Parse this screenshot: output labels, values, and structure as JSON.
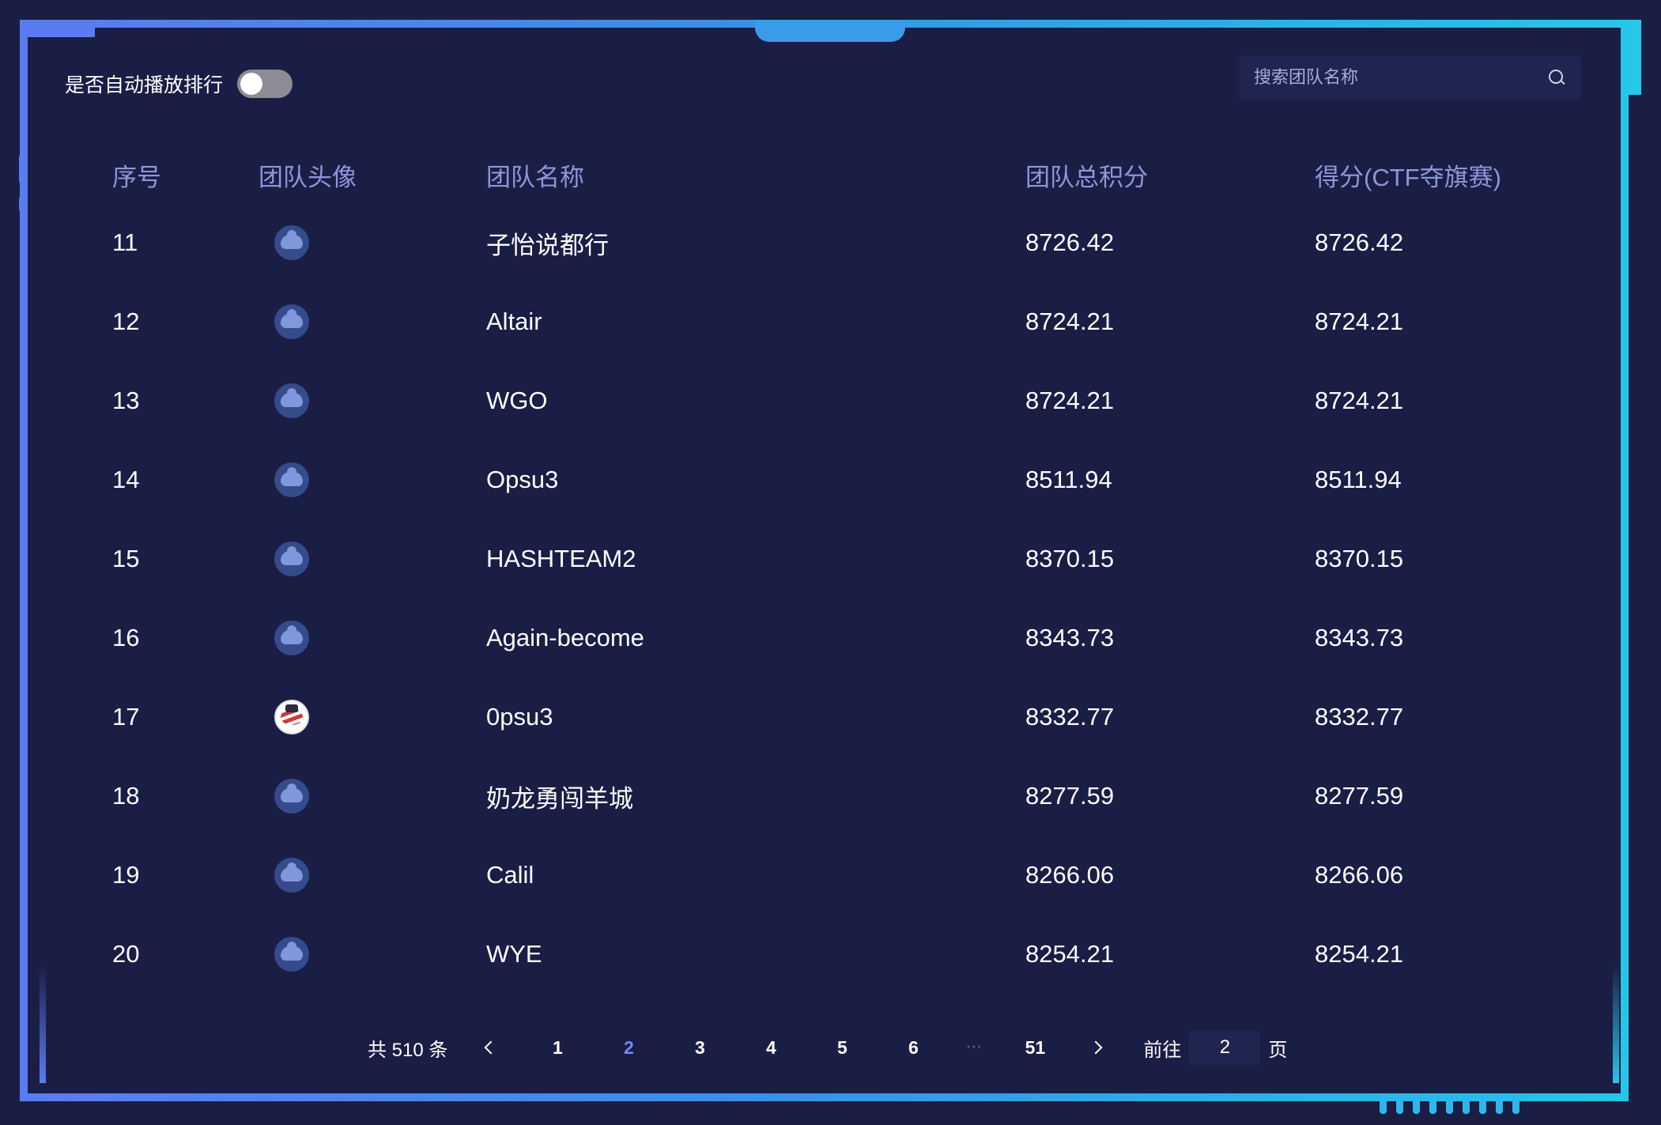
{
  "toolbar": {
    "autoplay_label": "是否自动播放排行",
    "autoplay_on": false,
    "search_placeholder": "搜索团队名称"
  },
  "table": {
    "headers": [
      "序号",
      "团队头像",
      "团队名称",
      "团队总积分",
      "得分(CTF夺旗赛)"
    ],
    "rows": [
      {
        "rank": "11",
        "avatar": "default-team-icon",
        "name": "子怡说都行",
        "total": "8726.42",
        "ctf": "8726.42"
      },
      {
        "rank": "12",
        "avatar": "default-team-icon",
        "name": "Altair",
        "total": "8724.21",
        "ctf": "8724.21"
      },
      {
        "rank": "13",
        "avatar": "default-team-icon",
        "name": "WGO",
        "total": "8724.21",
        "ctf": "8724.21"
      },
      {
        "rank": "14",
        "avatar": "default-team-icon",
        "name": "Opsu3",
        "total": "8511.94",
        "ctf": "8511.94"
      },
      {
        "rank": "15",
        "avatar": "default-team-icon",
        "name": "HASHTEAM2",
        "total": "8370.15",
        "ctf": "8370.15"
      },
      {
        "rank": "16",
        "avatar": "default-team-icon",
        "name": "Again-become",
        "total": "8343.73",
        "ctf": "8343.73"
      },
      {
        "rank": "17",
        "avatar": "badge-team-icon",
        "name": "0psu3",
        "total": "8332.77",
        "ctf": "8332.77"
      },
      {
        "rank": "18",
        "avatar": "default-team-icon",
        "name": "奶龙勇闯羊城",
        "total": "8277.59",
        "ctf": "8277.59"
      },
      {
        "rank": "19",
        "avatar": "default-team-icon",
        "name": "Calil",
        "total": "8266.06",
        "ctf": "8266.06"
      },
      {
        "rank": "20",
        "avatar": "default-team-icon",
        "name": "WYE",
        "total": "8254.21",
        "ctf": "8254.21"
      }
    ]
  },
  "pagination": {
    "total_text": "共 510 条",
    "pages": [
      "1",
      "2",
      "3",
      "4",
      "5",
      "6"
    ],
    "current": "2",
    "ellipsis": "···",
    "last": "51",
    "goto_prefix": "前往",
    "goto_value": "2",
    "goto_suffix": "页"
  },
  "colors": {
    "background": "#1a1e45",
    "frame_left": "#5b7cf0",
    "frame_right": "#27c5e8",
    "header_text": "#8f96d8",
    "active_page": "#6f8cf6"
  }
}
